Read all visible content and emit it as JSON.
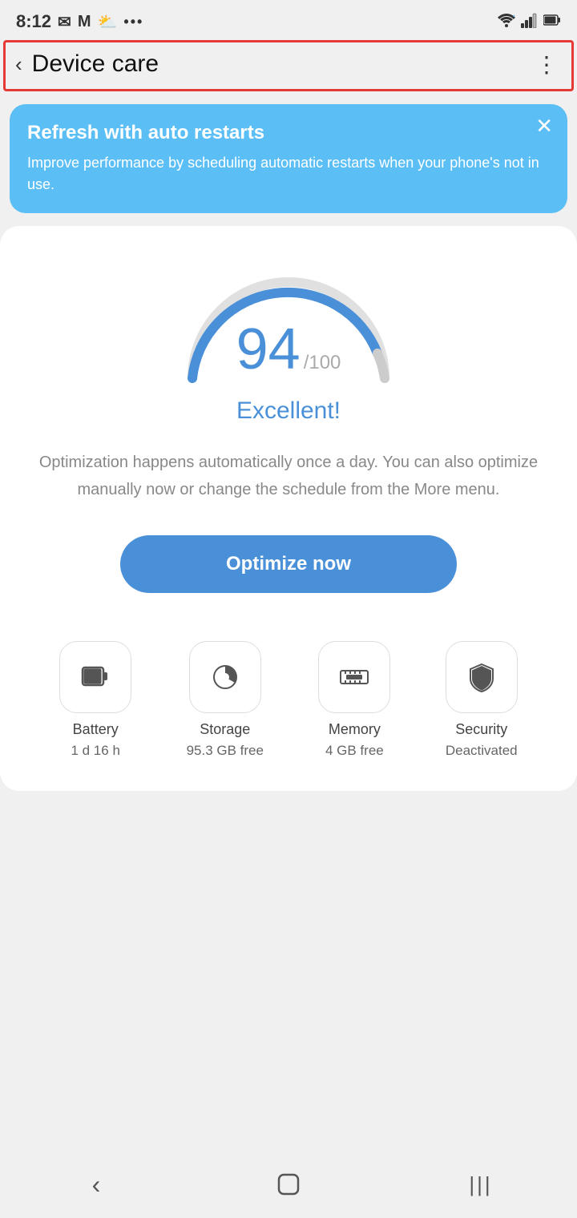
{
  "statusBar": {
    "time": "8:12",
    "icons": [
      "mail",
      "mail2",
      "weather",
      "more"
    ]
  },
  "header": {
    "back_label": "‹",
    "title": "Device care",
    "more_label": "⋮"
  },
  "banner": {
    "title": "Refresh with auto restarts",
    "description": "Improve performance by scheduling automatic restarts when your phone's not in use.",
    "close_label": "✕"
  },
  "scoreCard": {
    "score": "94",
    "total": "/100",
    "label": "Excellent!",
    "description": "Optimization happens automatically once a day. You can also optimize manually now or change the schedule from the More menu.",
    "optimizeButton": "Optimize now"
  },
  "bottomItems": [
    {
      "id": "battery",
      "label": "Battery",
      "value": "1 d 16 h",
      "icon": "battery"
    },
    {
      "id": "storage",
      "label": "Storage",
      "value": "95.3 GB free",
      "icon": "storage"
    },
    {
      "id": "memory",
      "label": "Memory",
      "value": "4 GB free",
      "icon": "memory"
    },
    {
      "id": "security",
      "label": "Security",
      "value": "Deactivated",
      "icon": "security"
    }
  ],
  "navBar": {
    "back_label": "‹",
    "home_label": "⬜",
    "recent_label": "|||"
  }
}
